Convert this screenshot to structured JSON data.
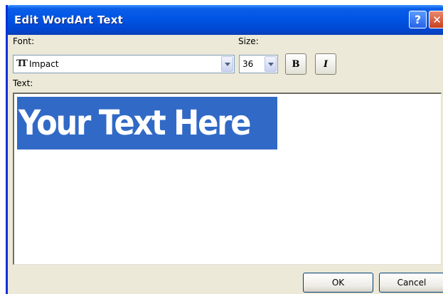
{
  "window": {
    "title": "Edit WordArt Text",
    "help_label": "?",
    "close_label": "✕"
  },
  "font": {
    "label": "Font:",
    "value": "Impact",
    "icon": "truetype-icon",
    "icon_glyph": "TT"
  },
  "size": {
    "label": "Size:",
    "value": "36"
  },
  "style": {
    "bold_label": "B",
    "italic_label": "I"
  },
  "text": {
    "label": "Text:",
    "value": "Your Text Here",
    "selection_color": "#3169c6"
  },
  "buttons": {
    "ok_label": "OK",
    "cancel_label": "Cancel"
  },
  "colors": {
    "titlebar": "#0055e5",
    "dialog_bg": "#ece9d8"
  }
}
